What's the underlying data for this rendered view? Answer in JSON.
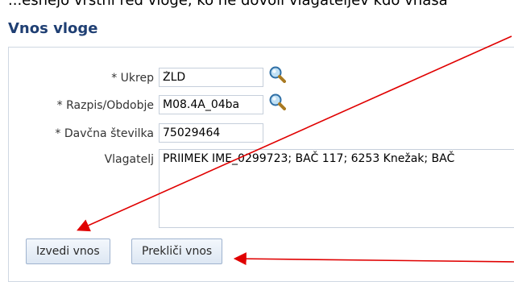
{
  "header": {
    "top_text": "...esnejo vrstni red vloge, ko ne dovoli vlagateljev  kdo vnasa",
    "title": "Vnos vloge"
  },
  "form": {
    "ukrep": {
      "label": "* Ukrep",
      "value": "ŽLD"
    },
    "razpis": {
      "label": "* Razpis/Obdobje",
      "value": "M08.4A_04ba"
    },
    "davcna": {
      "label": "* Davčna številka",
      "value": "75029464"
    },
    "vlagatelj": {
      "label": "Vlagatelj",
      "value": "PRIIMEK IME_0299723; BAČ 117; 6253 Knežak; BAČ"
    }
  },
  "buttons": {
    "submit_label": "Izvedi vnos",
    "cancel_label": "Prekliči vnos"
  },
  "icons": {
    "search": "magnifier-icon",
    "annotation_color": "#e00000"
  }
}
